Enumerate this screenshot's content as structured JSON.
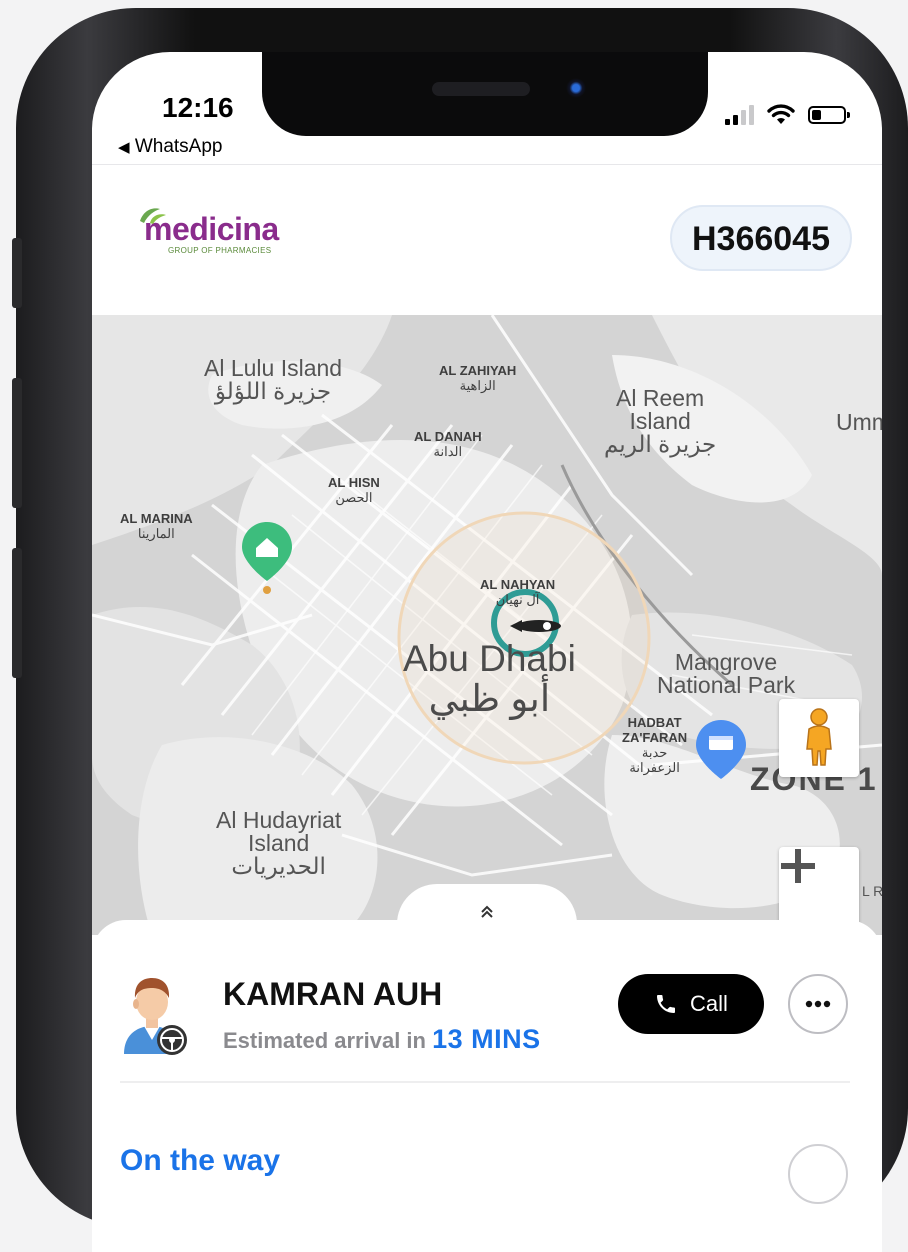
{
  "status_bar": {
    "time": "12:16",
    "back_app": "WhatsApp"
  },
  "header": {
    "logo_text": "medicina",
    "logo_tagline": "GROUP OF PHARMACIES",
    "order_id": "H366045"
  },
  "map": {
    "labels": {
      "al_lulu": "Al Lulu Island",
      "al_lulu_ar": "جزيرة اللؤلؤ",
      "al_zahiyah": "AL ZAHIYAH",
      "al_zahiyah_ar": "الزاهية",
      "al_reem_1": "Al Reem",
      "al_reem_2": "Island",
      "al_reem_ar": "جزيرة الريم",
      "umm": "Umm",
      "al_danah": "AL DANAH",
      "al_danah_ar": "الدانة",
      "al_hisn": "AL HISN",
      "al_hisn_ar": "الحصن",
      "al_marina": "AL MARINA",
      "al_marina_ar": "المارينا",
      "al_nahyan": "AL NAHYAN",
      "al_nahyan_ar": "آل نهيان",
      "abu_dhabi": "Abu Dhabi",
      "abu_dhabi_ar": "أبو ظبي",
      "mangrove_1": "Mangrove",
      "mangrove_2": "National Park",
      "hadbat_1": "HADBAT",
      "hadbat_2": "ZA'FARAN",
      "hadbat_ar_1": "حدبة",
      "hadbat_ar_2": "الزعفرانة",
      "zone": "ZONE 1",
      "hudayriat_1": "Al Hudayriat",
      "hudayriat_2": "Island",
      "hudayriat_ar": "الحديريات",
      "edge_r": "L R"
    },
    "colors": {
      "home_pin": "#3dbd7d",
      "store_pin": "#4d8ff0",
      "radius_ring": "#f0d7b8",
      "driver_ring": "#2f9c95"
    }
  },
  "driver": {
    "name": "KAMRAN AUH",
    "eta_prefix": "Estimated arrival in",
    "eta_value": "13 MINS",
    "call_label": "Call"
  },
  "delivery": {
    "status": "On the way"
  }
}
